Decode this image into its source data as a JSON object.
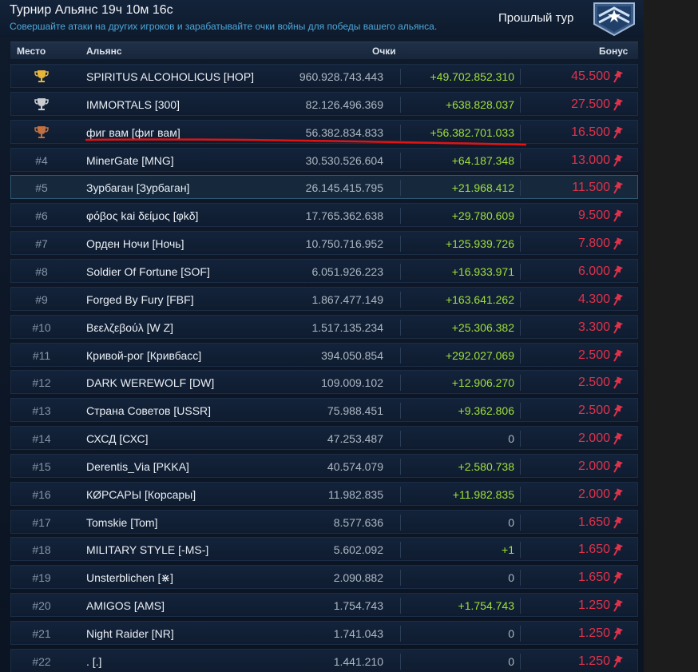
{
  "header": {
    "title": "Турнир Альянс 19ч 10м 16с",
    "subtitle": "Совершайте атаки на других игроков и зарабатывайте очки войны для победы вашего альянса.",
    "prev_tour_label": "Прошлый тур"
  },
  "columns": {
    "place": "Место",
    "alliance": "Альянс",
    "score": "Очки",
    "bonus": "Бонус"
  },
  "colors": {
    "gain": "#9ee03a",
    "bonus": "#e0324a",
    "subtitle": "#4da7d9",
    "gold": "#e8b53a",
    "silver": "#c9ccd1",
    "bronze": "#c2703f"
  },
  "rows": [
    {
      "place": "",
      "trophy": "gold",
      "name": "SPIRITUS ALCOHOLICUS [HOP]",
      "score": "960.928.743.443",
      "gain": "+49.702.852.310",
      "bonus": "45.500"
    },
    {
      "place": "",
      "trophy": "silver",
      "name": "IMMORTALS [300]",
      "score": "82.126.496.369",
      "gain": "+638.828.037",
      "bonus": "27.500"
    },
    {
      "place": "",
      "trophy": "bronze",
      "name": "фиг вам [фиг вам]",
      "score": "56.382.834.833",
      "gain": "+56.382.701.033",
      "bonus": "16.500"
    },
    {
      "place": "#4",
      "name": "MinerGate [MNG]",
      "score": "30.530.526.604",
      "gain": "+64.187.348",
      "bonus": "13.000"
    },
    {
      "place": "#5",
      "name": "Зурбаган [Зурбаган]",
      "score": "26.145.415.795",
      "gain": "+21.968.412",
      "bonus": "11.500",
      "selected": true
    },
    {
      "place": "#6",
      "name": "φόβος kai δείμος [φkδ]",
      "score": "17.765.362.638",
      "gain": "+29.780.609",
      "bonus": "9.500"
    },
    {
      "place": "#7",
      "name": "Орден Ночи [Ночь]",
      "score": "10.750.716.952",
      "gain": "+125.939.726",
      "bonus": "7.800"
    },
    {
      "place": "#8",
      "name": "Soldier Of Fortune [SOF]",
      "score": "6.051.926.223",
      "gain": "+16.933.971",
      "bonus": "6.000"
    },
    {
      "place": "#9",
      "name": "Forged By Fury [FBF]",
      "score": "1.867.477.149",
      "gain": "+163.641.262",
      "bonus": "4.300"
    },
    {
      "place": "#10",
      "name": "Βεελζεβούλ [W Z]",
      "score": "1.517.135.234",
      "gain": "+25.306.382",
      "bonus": "3.300"
    },
    {
      "place": "#11",
      "name": "Кривой-рог [Кривбасс]",
      "score": "394.050.854",
      "gain": "+292.027.069",
      "bonus": "2.500"
    },
    {
      "place": "#12",
      "name": "DARK WEREWOLF [DW]",
      "score": "109.009.102",
      "gain": "+12.906.270",
      "bonus": "2.500"
    },
    {
      "place": "#13",
      "name": "Страна Советов [USSR]",
      "score": "75.988.451",
      "gain": "+9.362.806",
      "bonus": "2.500"
    },
    {
      "place": "#14",
      "name": "СХСД [СХС]",
      "score": "47.253.487",
      "gain": "0",
      "bonus": "2.000"
    },
    {
      "place": "#15",
      "name": "Derentis_Via [PKKA]",
      "score": "40.574.079",
      "gain": "+2.580.738",
      "bonus": "2.000"
    },
    {
      "place": "#16",
      "name": "КØРСАРЫ [Корсары]",
      "score": "11.982.835",
      "gain": "+11.982.835",
      "bonus": "2.000"
    },
    {
      "place": "#17",
      "name": "Tomskie [Tom]",
      "score": "8.577.636",
      "gain": "0",
      "bonus": "1.650"
    },
    {
      "place": "#18",
      "name": "MILITARY STYLE [-MS-]",
      "score": "5.602.092",
      "gain": "+1",
      "bonus": "1.650"
    },
    {
      "place": "#19",
      "name": "Unsterblichen [⋇]",
      "score": "2.090.882",
      "gain": "0",
      "bonus": "1.650"
    },
    {
      "place": "#20",
      "name": "AMIGOS [AMS]",
      "score": "1.754.743",
      "gain": "+1.754.743",
      "bonus": "1.250"
    },
    {
      "place": "#21",
      "name": "Night Raider [NR]",
      "score": "1.741.043",
      "gain": "0",
      "bonus": "1.250"
    },
    {
      "place": "#22",
      "name": ". [.]",
      "score": "1.441.210",
      "gain": "0",
      "bonus": "1.250"
    }
  ]
}
